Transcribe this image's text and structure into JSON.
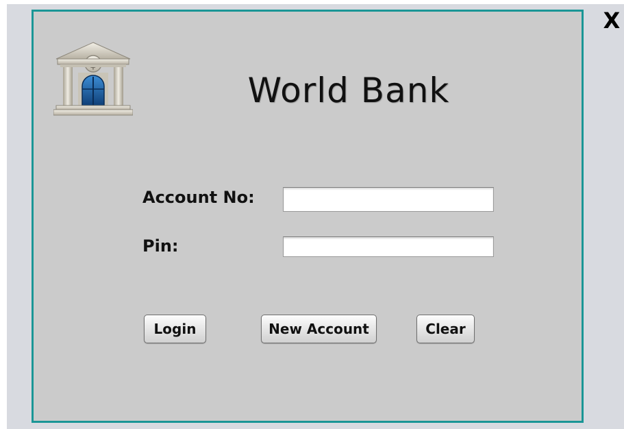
{
  "window": {
    "close_label": "X"
  },
  "header": {
    "title": "World Bank",
    "logo_icon": "bank-icon"
  },
  "form": {
    "account_label": "Account No:",
    "account_value": "",
    "pin_label": "Pin:",
    "pin_value": ""
  },
  "buttons": {
    "login": "Login",
    "new_account": "New Account",
    "clear": "Clear"
  },
  "colors": {
    "panel_background": "#cbcbcb",
    "panel_border": "#1a9696",
    "backdrop": "#d8dae0"
  }
}
